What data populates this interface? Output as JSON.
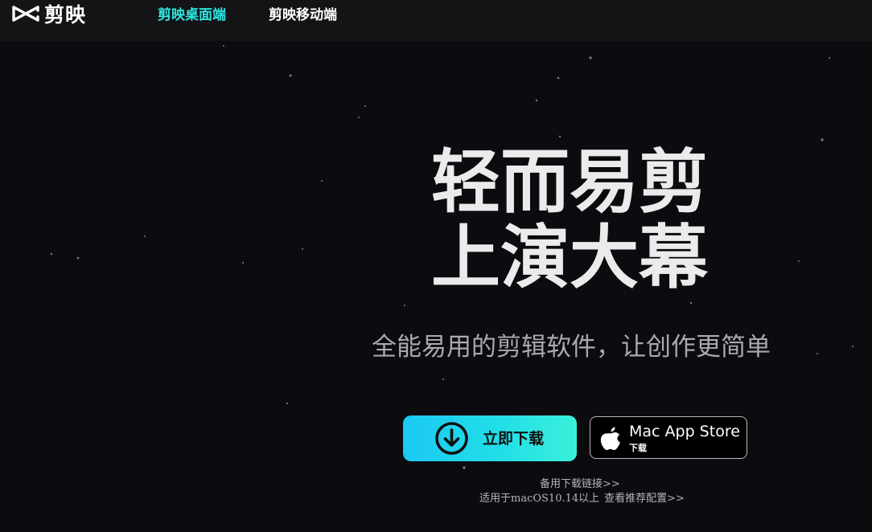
{
  "header": {
    "logo_text": "剪映",
    "nav": [
      {
        "label": "剪映桌面端",
        "active": true
      },
      {
        "label": "剪映移动端",
        "active": false
      }
    ]
  },
  "hero": {
    "headline_line1": "轻而易剪",
    "headline_line2": "上演大幕",
    "subtitle": "全能易用的剪辑软件，让创作更简单"
  },
  "buttons": {
    "download_label": "立即下载",
    "appstore_title": "Mac App Store",
    "appstore_sub": "下载"
  },
  "links": {
    "backup": "备用下载链接>>",
    "compat_text": "适用于macOS10.14以上",
    "requirements": "查看推荐配置>>"
  },
  "colors": {
    "accent": "#2fe6e0",
    "background": "#0b0b10",
    "header_bg": "#141417"
  },
  "icons": {
    "logo": "capcut-logo-icon",
    "download": "download-arrow-icon",
    "apple": "apple-icon"
  }
}
